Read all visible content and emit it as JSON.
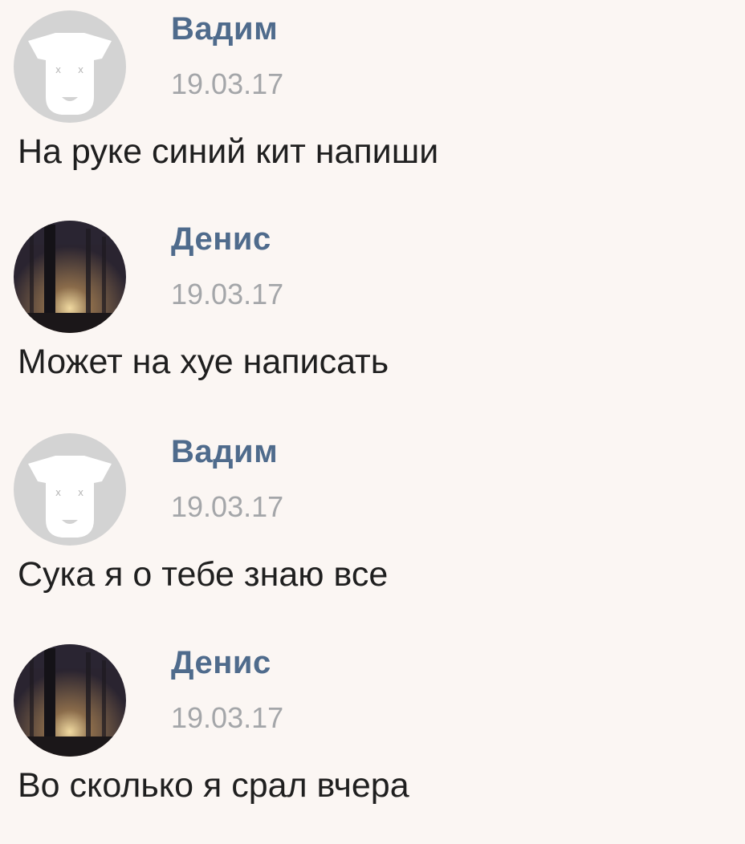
{
  "messages": [
    {
      "author": "Вадим",
      "date": "19.03.17",
      "text": "На руке синий кит напиши",
      "avatar_icon": "default-dog-avatar-icon"
    },
    {
      "author": "Денис",
      "date": "19.03.17",
      "text": "Может на хуе написать",
      "avatar_icon": "dark-forest-photo"
    },
    {
      "author": "Вадим",
      "date": "19.03.17",
      "text": "Сука я о тебе знаю все",
      "avatar_icon": "default-dog-avatar-icon"
    },
    {
      "author": "Денис",
      "date": "19.03.17",
      "text": "Во сколько я срал вчера",
      "avatar_icon": "dark-forest-photo"
    }
  ],
  "colors": {
    "background": "#fbf6f3",
    "author_name": "#4f6b8c",
    "date": "#a4a6a9",
    "message_text": "#1f1f1f"
  }
}
